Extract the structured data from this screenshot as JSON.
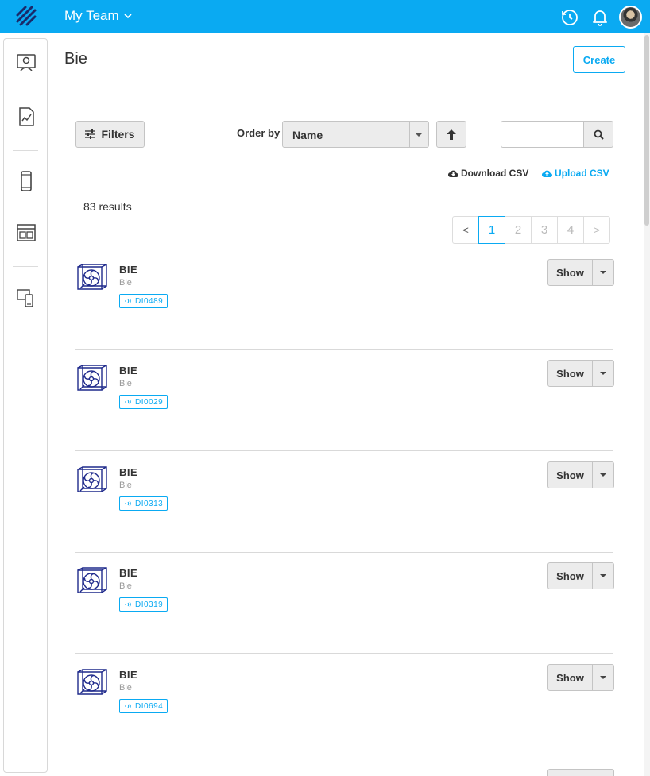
{
  "header": {
    "team_label": "My Team"
  },
  "page": {
    "title": "Bie",
    "create_label": "Create"
  },
  "toolbar": {
    "filters_label": "Filters",
    "order_by_label": "Order by",
    "order_by_value": "Name",
    "search_placeholder": "",
    "download_csv_label": "Download CSV",
    "upload_csv_label": "Upload CSV"
  },
  "results_text": "83 results",
  "pagination": {
    "prev": "<",
    "pages": [
      "1",
      "2",
      "3",
      "4"
    ],
    "next": ">",
    "current": "1"
  },
  "items": [
    {
      "title": "BIE",
      "subtitle": "Bie",
      "tag": "DI0489",
      "show_label": "Show"
    },
    {
      "title": "BIE",
      "subtitle": "Bie",
      "tag": "DI0029",
      "show_label": "Show"
    },
    {
      "title": "BIE",
      "subtitle": "Bie",
      "tag": "DI0313",
      "show_label": "Show"
    },
    {
      "title": "BIE",
      "subtitle": "Bie",
      "tag": "DI0319",
      "show_label": "Show"
    },
    {
      "title": "BIE",
      "subtitle": "Bie",
      "tag": "DI0694",
      "show_label": "Show"
    }
  ],
  "colors": {
    "accent": "#0aaaf2",
    "button_bg": "#ececec",
    "device_icon": "#1f2a8c"
  },
  "icons": {
    "topbar": [
      "logo-icon",
      "history-icon",
      "bell-icon",
      "avatar"
    ],
    "sidebar": [
      "monitor-user-icon",
      "chart-report-icon",
      "smartphone-icon",
      "dashboard-layout-icon",
      "devices-icon"
    ]
  }
}
